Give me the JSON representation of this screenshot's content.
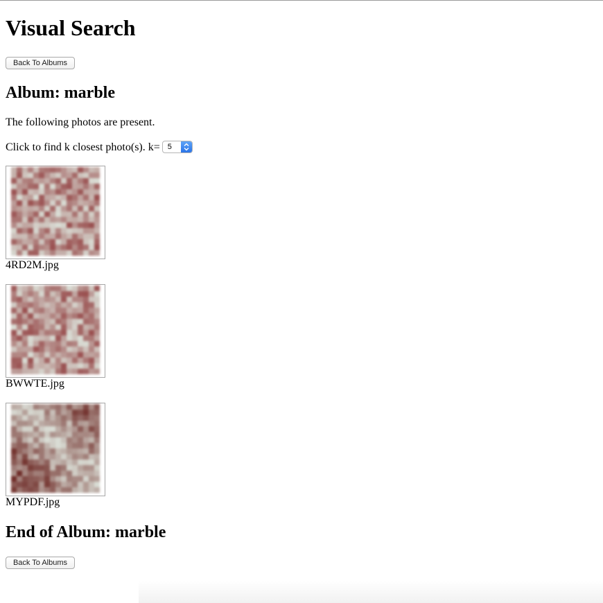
{
  "page": {
    "title": "Visual Search",
    "back_button_label": "Back To Albums",
    "album_heading": "Album: marble",
    "intro_text": "The following photos are present.",
    "k_prompt": "Click to find k closest photo(s). k=",
    "k_value": "5",
    "end_heading": "End of Album: marble"
  },
  "photos": [
    {
      "filename": "4RD2M.jpg",
      "thumbnail": "marble-texture-red-white"
    },
    {
      "filename": "BWWTE.jpg",
      "thumbnail": "marble-texture-red-white"
    },
    {
      "filename": "MYPDF.jpg",
      "thumbnail": "marble-texture-dark-red"
    }
  ],
  "colors": {
    "marble_red": "#9a5050",
    "marble_white": "#d9dcd4",
    "marble_dark": "#6e2a26",
    "select_accent": "#3a83ee"
  }
}
